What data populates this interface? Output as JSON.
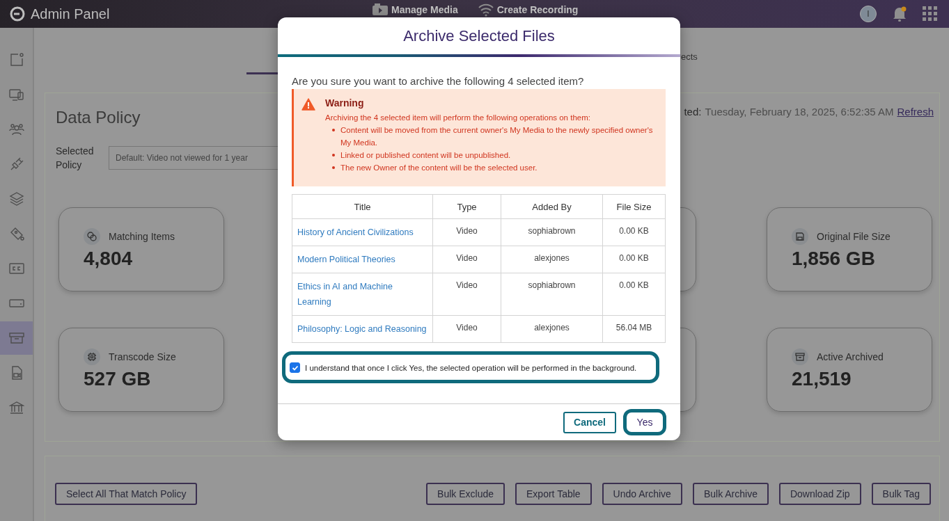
{
  "top_bar": {
    "title": "Admin Panel",
    "nav": [
      "Manage Media",
      "Create Recording"
    ],
    "avatar": "I",
    "notification_dot": true
  },
  "sidebar": {
    "items": [
      {
        "selected": false
      },
      {
        "selected": false
      },
      {
        "selected": false
      },
      {
        "selected": false
      },
      {
        "selected": false
      },
      {
        "selected": false
      },
      {
        "selected": false
      },
      {
        "selected": false
      },
      {
        "selected": true
      },
      {
        "selected": false
      },
      {
        "selected": false
      }
    ]
  },
  "tabs": {
    "partial_label": "ects"
  },
  "page": {
    "heading": "Data Policy",
    "policy_label": "Selected Policy",
    "policy_value": "Default: Video not viewed for 1 year",
    "updated_label": "ted:",
    "updated_value": "Tuesday, February 18, 2025, 6:52:35 AM",
    "refresh": "Refresh",
    "stat_rows": [
      [
        {
          "label": "Matching Items",
          "value": "4,804"
        },
        {
          "label": "Original File Size",
          "value": "1,856 GB"
        }
      ],
      [
        {
          "label": "Transcode Size",
          "value": "527 GB"
        },
        {
          "label": "Active Archived",
          "value": "21,519"
        }
      ]
    ],
    "left_buttons": [
      "Select All That Match Policy"
    ],
    "right_buttons": [
      "Bulk Exclude",
      "Export Table",
      "Undo Archive",
      "Bulk Archive",
      "Download Zip",
      "Bulk Tag"
    ]
  },
  "dialog": {
    "title": "Archive Selected Files",
    "question": "Are you sure you want to archive the following 4 selected item?",
    "warning": {
      "title": "Warning",
      "text": "Archiving the 4 selected item will perform the following operations on them:",
      "bullets": [
        "Content will be moved from the current owner's My Media to the newly specified owner's My Media.",
        "Linked or published content will be unpublished.",
        "The new Owner of the content will be the selected user."
      ]
    },
    "table": {
      "columns": [
        "Title",
        "Type",
        "Added By",
        "File Size"
      ],
      "rows": [
        [
          "History of Ancient Civilizations",
          "Video",
          "sophiabrown",
          "0.00 KB"
        ],
        [
          "Modern Political Theories",
          "Video",
          "alexjones",
          "0.00 KB"
        ],
        [
          "Ethics in AI and Machine Learning",
          "Video",
          "sophiabrown",
          "0.00 KB"
        ],
        [
          "Philosophy: Logic and Reasoning",
          "Video",
          "alexjones",
          "56.04 MB"
        ]
      ]
    },
    "confirm": {
      "label": "I understand that once I click Yes, the selected operation will be performed in the background.",
      "checked": true
    },
    "buttons": {
      "cancel": "Cancel",
      "confirm": "Yes"
    }
  }
}
